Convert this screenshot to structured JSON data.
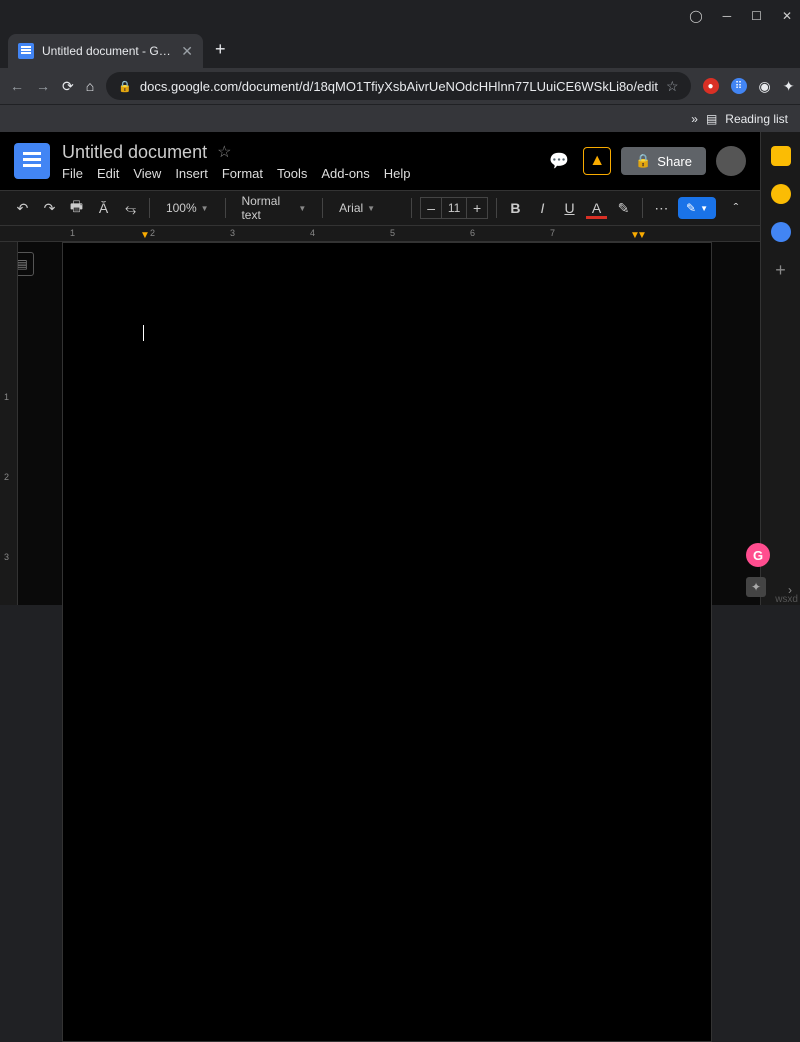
{
  "browser": {
    "tab_title": "Untitled document - Google Doc",
    "url": "docs.google.com/document/d/18qMO1TfiyXsbAivrUeNOdcHHlnn77LUuiCE6WSkLi8o/edit",
    "reading_list": "Reading list"
  },
  "doc": {
    "title": "Untitled document",
    "menu": {
      "file": "File",
      "edit": "Edit",
      "view": "View",
      "insert": "Insert",
      "format": "Format",
      "tools": "Tools",
      "addons": "Add-ons",
      "help": "Help"
    },
    "share": "Share"
  },
  "toolbar": {
    "zoom": "100%",
    "style": "Normal text",
    "font": "Arial",
    "size": "11",
    "minus": "–",
    "plus": "+",
    "bold": "B",
    "italic": "I",
    "underline": "U",
    "textcolor": "A"
  },
  "ruler": {
    "r1": "1",
    "r2": "2",
    "r3": "3",
    "r4": "4",
    "r5": "5",
    "r6": "6",
    "r7": "7"
  },
  "watermark": "wsxd"
}
